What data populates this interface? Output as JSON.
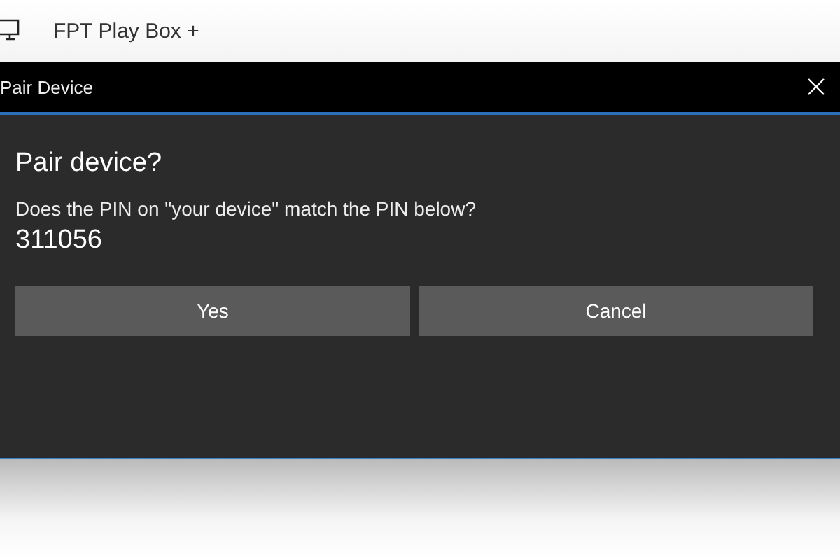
{
  "app": {
    "title": "FPT Play Box +"
  },
  "dialog": {
    "title": "Pair Device",
    "heading": "Pair device?",
    "message": "Does the PIN on \"your device\" match the PIN below?",
    "pin": "311056",
    "buttons": [
      "Yes",
      "Cancel"
    ]
  }
}
